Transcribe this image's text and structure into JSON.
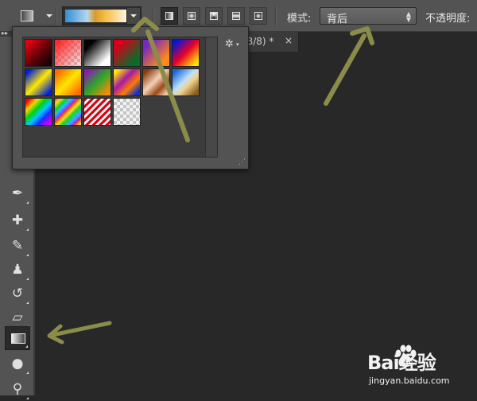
{
  "options_bar": {
    "tool_preset_icon": "gradient-preset-icon",
    "gradient_editor": {
      "colors": [
        "#2f8fd8",
        "#b6d6ee",
        "#d89b2a",
        "#f7c04a",
        "#fff6e3"
      ]
    },
    "gradient_types": [
      "linear",
      "radial",
      "angle",
      "reflected",
      "diamond"
    ],
    "selected_gradient_type": "linear",
    "mode_label": "模式:",
    "mode_value": "背后",
    "opacity_label": "不透明度:"
  },
  "document_tab": {
    "title": "B/8) *",
    "close_label": "×"
  },
  "gradient_presets": {
    "settings_icon": "gear-icon",
    "swatches": [
      {
        "name": "red-black",
        "css": "linear-gradient(135deg,#ff0010 0%,#600008 55%,#000 100%)"
      },
      {
        "name": "red-transparent",
        "css": "linear-gradient(135deg,#ff1a1a 0%,rgba(255,40,40,0.1) 100%)",
        "checker": true
      },
      {
        "name": "black-white",
        "css": "linear-gradient(135deg,#000 20%,#fff 80%)"
      },
      {
        "name": "red-green",
        "css": "linear-gradient(135deg,#d4001a 20%,#0b6b2a 80%)"
      },
      {
        "name": "violet-orange",
        "css": "linear-gradient(135deg,#7a2ab8 20%,#ff8a1a 80%)"
      },
      {
        "name": "blue-red-yellow",
        "css": "linear-gradient(135deg,#0016d8 10%,#e8002a 50%,#ffe600 90%)"
      },
      {
        "name": "blue-yellow-blue",
        "css": "linear-gradient(135deg,#001fd8 10%,#ffe800 50%,#001fd8 90%)"
      },
      {
        "name": "orange-yellow-orange",
        "css": "linear-gradient(135deg,#ff6a00 10%,#ffe600 50%,#ff6a00 90%)"
      },
      {
        "name": "violet-green-orange",
        "css": "linear-gradient(135deg,#8a1ab0 10%,#2ca82c 50%,#ff8a00 90%)"
      },
      {
        "name": "yellow-violet-orange-blue",
        "css": "linear-gradient(135deg,#ffe400 10%,#a21aa8 40%,#ff7a00 65%,#1030c8 90%)"
      },
      {
        "name": "copper",
        "css": "linear-gradient(135deg,#8a3a10 10%,#f3d1b5 45%,#9a4a1a 70%,#f3c3a0 90%)"
      },
      {
        "name": "chrome",
        "css": "linear-gradient(135deg,#1a6ad8 10%,#bfe0ff 45%,#f0d28a 60%,#8a5a1a 90%)"
      },
      {
        "name": "spectrum",
        "css": "linear-gradient(135deg,#ff0000 8%,#ffd400 24%,#00d400 40%,#00c8ff 56%,#1030ff 72%,#c000ff 88%)"
      },
      {
        "name": "transparent-rainbow",
        "css": "repeating-linear-gradient(135deg,rgba(255,0,0,0.85) 0px,rgba(255,220,0,0.85) 5px,rgba(0,200,0,0.85) 10px,rgba(0,180,255,0.85) 15px,rgba(150,0,255,0.85) 20px)",
        "checker": true
      },
      {
        "name": "transparent-stripes",
        "css": "repeating-linear-gradient(135deg,#e00010 0px,#e00010 3px,rgba(255,255,255,0.9) 3px,rgba(255,255,255,0.9) 6px)",
        "checker": true
      },
      {
        "name": "neutral-density",
        "css": "linear-gradient(135deg,rgba(0,0,0,0.05),rgba(0,0,0,0.05))",
        "checker": true
      }
    ]
  },
  "tools_panel": {
    "tools": [
      {
        "name": "eyedropper-tool-icon",
        "glyph": "✒"
      },
      {
        "name": "healing-brush-tool-icon",
        "glyph": "✚"
      },
      {
        "name": "brush-tool-icon",
        "glyph": "✎"
      },
      {
        "name": "clone-stamp-tool-icon",
        "glyph": "♟"
      },
      {
        "name": "history-brush-tool-icon",
        "glyph": "↺"
      },
      {
        "name": "eraser-tool-icon",
        "glyph": "▱"
      },
      {
        "name": "gradient-tool-icon",
        "glyph": ""
      },
      {
        "name": "blur-tool-icon",
        "glyph": "●"
      },
      {
        "name": "dodge-tool-icon",
        "glyph": "⚲"
      }
    ]
  },
  "annotation_color": "#8c8c4a",
  "watermark": {
    "logo": "Bai经验",
    "url": "jingyan.baidu.com"
  }
}
